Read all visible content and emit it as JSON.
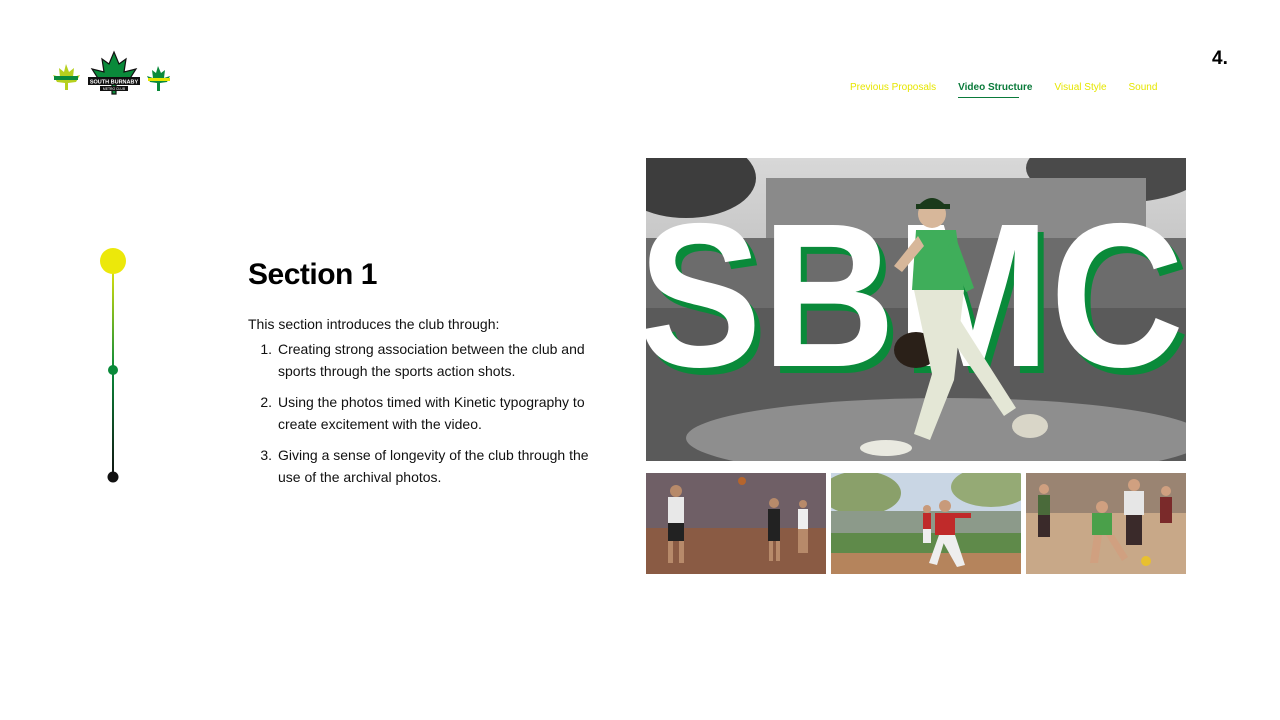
{
  "page_number": "4.",
  "nav": {
    "items": [
      {
        "label": "Previous Proposals",
        "active": false
      },
      {
        "label": "Video Structure",
        "active": true
      },
      {
        "label": "Visual Style",
        "active": false
      },
      {
        "label": "Sound",
        "active": false
      }
    ]
  },
  "logos": {
    "center_logo_text": "SOUTH BURNABY",
    "center_logo_subtext": "METRO CLUB"
  },
  "section": {
    "title": "Section 1",
    "intro": "This section introduces the club through:",
    "points": [
      {
        "num": "1.",
        "text": "Creating strong association between the club and sports through the sports action shots."
      },
      {
        "num": "2.",
        "text": "Using the photos timed with Kinetic typography to create excitement with the video."
      },
      {
        "num": "3.",
        "text": "Giving a sense of longevity of the club through the use of the archival photos."
      }
    ]
  },
  "hero": {
    "overlay_text": "SBMC"
  },
  "colors": {
    "yellow": "#ece80a",
    "green": "#0a8a3a",
    "black": "#111111"
  }
}
